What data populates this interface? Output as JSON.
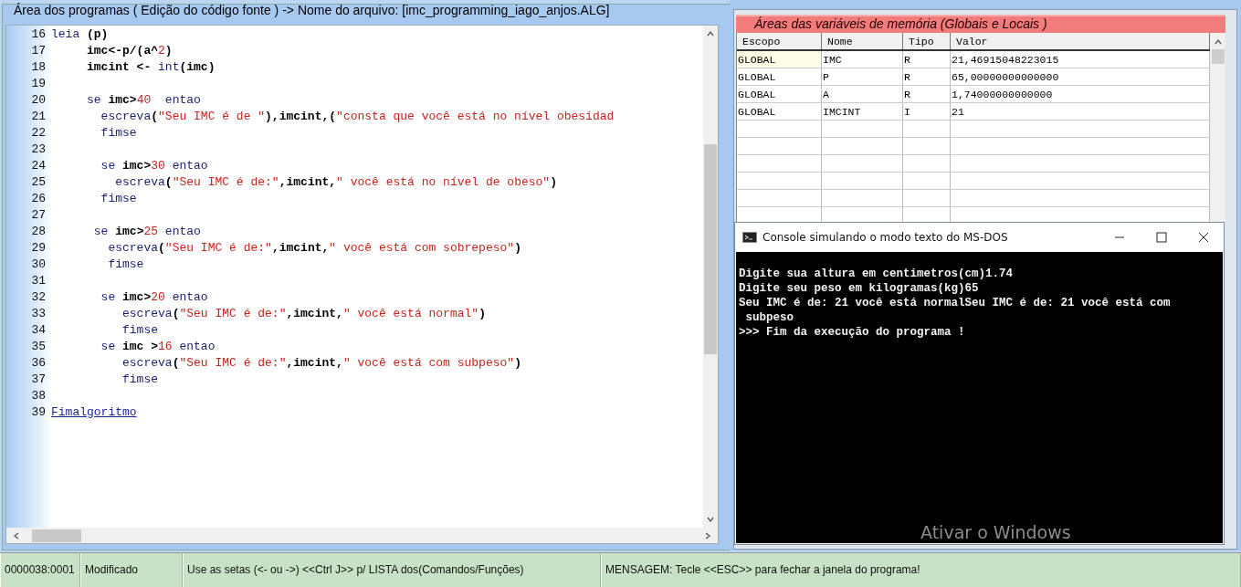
{
  "editor": {
    "title": "Área dos programas ( Edição do código fonte ) -> Nome do arquivo: [imc_programming_iago_anjos.ALG]",
    "lines": [
      {
        "number": "16",
        "tokens": [
          {
            "kind": "kw",
            "text": "leia"
          },
          {
            "kind": "id",
            "text": " (p)"
          }
        ]
      },
      {
        "number": "17",
        "tokens": [
          {
            "kind": "id",
            "text": "     imc<-p/(a^"
          },
          {
            "kind": "num",
            "text": "2"
          },
          {
            "kind": "id",
            "text": ")"
          }
        ]
      },
      {
        "number": "18",
        "tokens": [
          {
            "kind": "id",
            "text": "     imcint <- "
          },
          {
            "kind": "kw",
            "text": "int"
          },
          {
            "kind": "id",
            "text": "(imc)"
          }
        ]
      },
      {
        "number": "19"
      },
      {
        "number": "20",
        "tokens": [
          {
            "kind": "kw",
            "text": "     se"
          },
          {
            "kind": "id",
            "text": " imc>"
          },
          {
            "kind": "num",
            "text": "40"
          },
          {
            "kind": "kw",
            "text": "  entao"
          }
        ]
      },
      {
        "number": "21",
        "tokens": [
          {
            "kind": "kw",
            "text": "       escreva"
          },
          {
            "kind": "id",
            "text": "("
          },
          {
            "kind": "str",
            "text": "\"Seu IMC é de \""
          },
          {
            "kind": "id",
            "text": "),imcint,("
          },
          {
            "kind": "str",
            "text": "\"consta que você está no nível obesidad"
          }
        ]
      },
      {
        "number": "22",
        "tokens": [
          {
            "kind": "kw",
            "text": "       fimse"
          }
        ]
      },
      {
        "number": "23"
      },
      {
        "number": "24",
        "tokens": [
          {
            "kind": "kw",
            "text": "       se"
          },
          {
            "kind": "id",
            "text": " imc>"
          },
          {
            "kind": "num",
            "text": "30"
          },
          {
            "kind": "kw",
            "text": " entao"
          }
        ]
      },
      {
        "number": "25",
        "tokens": [
          {
            "kind": "kw",
            "text": "         escreva"
          },
          {
            "kind": "id",
            "text": "("
          },
          {
            "kind": "str",
            "text": "\"Seu IMC é de:\""
          },
          {
            "kind": "id",
            "text": ",imcint,"
          },
          {
            "kind": "str",
            "text": "\" você está no nível de obeso\""
          },
          {
            "kind": "id",
            "text": ")"
          }
        ]
      },
      {
        "number": "26",
        "tokens": [
          {
            "kind": "kw",
            "text": "       fimse"
          }
        ]
      },
      {
        "number": "27"
      },
      {
        "number": "28",
        "tokens": [
          {
            "kind": "kw",
            "text": "      se"
          },
          {
            "kind": "id",
            "text": " imc>"
          },
          {
            "kind": "num",
            "text": "25"
          },
          {
            "kind": "kw",
            "text": " entao"
          }
        ]
      },
      {
        "number": "29",
        "tokens": [
          {
            "kind": "kw",
            "text": "        escreva"
          },
          {
            "kind": "id",
            "text": "("
          },
          {
            "kind": "str",
            "text": "\"Seu IMC é de:\""
          },
          {
            "kind": "id",
            "text": ",imcint,"
          },
          {
            "kind": "str",
            "text": "\" você está com sobrepeso\""
          },
          {
            "kind": "id",
            "text": ")"
          }
        ]
      },
      {
        "number": "30",
        "tokens": [
          {
            "kind": "kw",
            "text": "        fimse"
          }
        ]
      },
      {
        "number": "31"
      },
      {
        "number": "32",
        "tokens": [
          {
            "kind": "kw",
            "text": "       se"
          },
          {
            "kind": "id",
            "text": " imc>"
          },
          {
            "kind": "num",
            "text": "20"
          },
          {
            "kind": "kw",
            "text": " entao"
          }
        ]
      },
      {
        "number": "33",
        "tokens": [
          {
            "kind": "kw",
            "text": "          escreva"
          },
          {
            "kind": "id",
            "text": "("
          },
          {
            "kind": "str",
            "text": "\"Seu IMC é de:\""
          },
          {
            "kind": "id",
            "text": ",imcint,"
          },
          {
            "kind": "str",
            "text": "\" você está normal\""
          },
          {
            "kind": "id",
            "text": ")"
          }
        ]
      },
      {
        "number": "34",
        "tokens": [
          {
            "kind": "kw",
            "text": "          fimse"
          }
        ]
      },
      {
        "number": "35",
        "tokens": [
          {
            "kind": "kw",
            "text": "       se"
          },
          {
            "kind": "id",
            "text": " imc >"
          },
          {
            "kind": "num",
            "text": "16"
          },
          {
            "kind": "kw",
            "text": " entao"
          }
        ]
      },
      {
        "number": "36",
        "tokens": [
          {
            "kind": "kw",
            "text": "          escreva"
          },
          {
            "kind": "id",
            "text": "("
          },
          {
            "kind": "str",
            "text": "\"Seu IMC é de:\""
          },
          {
            "kind": "id",
            "text": ",imcint,"
          },
          {
            "kind": "str",
            "text": "\" você está com subpeso\""
          },
          {
            "kind": "id",
            "text": ")"
          }
        ]
      },
      {
        "number": "37",
        "tokens": [
          {
            "kind": "kw",
            "text": "          fimse"
          }
        ]
      },
      {
        "number": "38"
      },
      {
        "number": "39",
        "tokens": [
          {
            "kind": "link",
            "text": "Fimalgoritmo"
          }
        ]
      }
    ]
  },
  "variables": {
    "title": "Áreas das variáveis de memória (Globais e Locais )",
    "columns": [
      "Escopo",
      "Nome",
      "Tipo",
      "Valor"
    ],
    "rows": [
      {
        "cells": [
          "GLOBAL",
          "IMC",
          "R",
          "21,46915048223015"
        ],
        "selected": true
      },
      {
        "cells": [
          "GLOBAL",
          "P",
          "R",
          "65,00000000000000"
        ],
        "selected": false
      },
      {
        "cells": [
          "GLOBAL",
          "A",
          "R",
          "1,74000000000000"
        ],
        "selected": false
      },
      {
        "cells": [
          "GLOBAL",
          "IMCINT",
          "I",
          "21"
        ],
        "selected": false
      }
    ]
  },
  "console": {
    "title": "Console simulando o modo texto do MS-DOS",
    "lines": [
      "Digite sua altura em centimetros(cm)1.74",
      "Digite seu peso em kilogramas(kg)65",
      "Seu IMC é de: 21 você está normalSeu IMC é de: 21 você está com",
      " subpeso",
      ">>> Fim da execução do programa !"
    ]
  },
  "status_bar": [
    "0000038:0001",
    "Modificado",
    "Use as setas (<- ou ->) <<Ctrl J>> p/ LISTA dos(Comandos/Funções)",
    "MENSAGEM: Tecle <<ESC>> para fechar a janela do programa!"
  ],
  "activation_notice": "Ativar o Windows"
}
